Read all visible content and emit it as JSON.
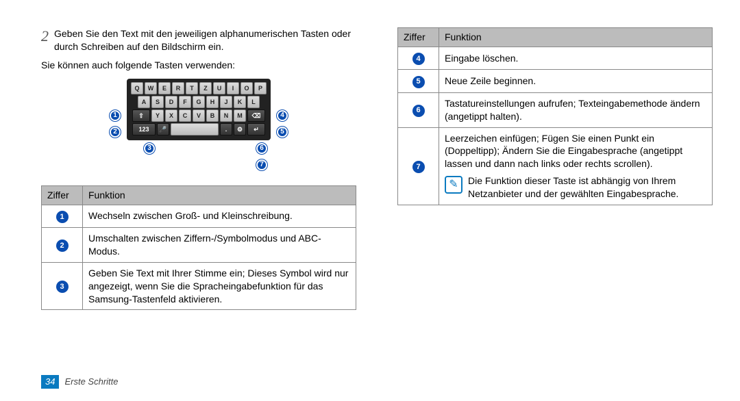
{
  "step": {
    "number": "2",
    "text": "Geben Sie den Text mit den jeweiligen alphanumerischen Tasten oder durch Schreiben auf den Bildschirm ein."
  },
  "after_note": "Sie können auch folgende Tasten verwenden:",
  "keyboard": {
    "row1": [
      "Q",
      "W",
      "E",
      "R",
      "T",
      "Z",
      "U",
      "I",
      "O",
      "P"
    ],
    "row2": [
      "A",
      "S",
      "D",
      "F",
      "G",
      "H",
      "J",
      "K",
      "L"
    ],
    "row3_shift": "⇧",
    "row3_letters": [
      "Y",
      "X",
      "C",
      "V",
      "B",
      "N",
      "M"
    ],
    "row3_del": "⌫",
    "row4_123": "123",
    "row4_mic": "🎤",
    "row4_space": " ",
    "row4_dot": ".",
    "row4_gear": "⚙",
    "row4_enter": "↵"
  },
  "callouts": {
    "1": "1",
    "2": "2",
    "3": "3",
    "4": "4",
    "5": "5",
    "6": "6",
    "7": "7"
  },
  "left_table": {
    "head_ziffer": "Ziffer",
    "head_funktion": "Funktion",
    "rows": [
      {
        "n": "1",
        "t": "Wechseln zwischen Groß- und Kleinschreibung."
      },
      {
        "n": "2",
        "t": "Umschalten zwischen Ziffern-/Symbolmodus und ABC-Modus."
      },
      {
        "n": "3",
        "t": "Geben Sie Text mit Ihrer Stimme ein; Dieses Symbol wird nur angezeigt, wenn Sie die Spracheingabefunktion für das Samsung-Tastenfeld aktivieren."
      }
    ]
  },
  "right_table": {
    "head_ziffer": "Ziffer",
    "head_funktion": "Funktion",
    "rows": [
      {
        "n": "4",
        "t": "Eingabe löschen."
      },
      {
        "n": "5",
        "t": "Neue Zeile beginnen."
      },
      {
        "n": "6",
        "t": "Tastatureinstellungen aufrufen; Texteingabemethode ändern (angetippt halten)."
      },
      {
        "n": "7",
        "t": "Leerzeichen einfügen; Fügen Sie einen Punkt ein (Doppeltipp); Ändern Sie die Eingabesprache (angetippt lassen und dann nach links oder rechts scrollen).",
        "note": "Die Funktion dieser Taste ist abhängig von Ihrem Netzanbieter und der gewählten Eingabesprache."
      }
    ]
  },
  "footer": {
    "page": "34",
    "section": "Erste Schritte"
  }
}
